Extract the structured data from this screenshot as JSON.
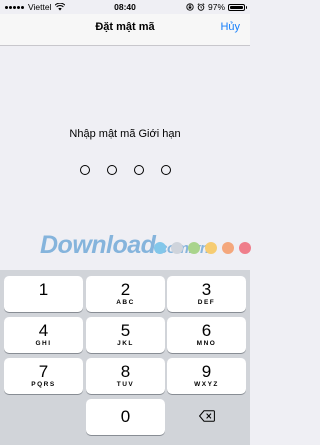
{
  "status_bar": {
    "carrier": "Viettel",
    "time": "08:40",
    "battery": "97%",
    "battery_level": 0.97
  },
  "nav": {
    "title": "Đặt mật mã",
    "cancel_label": "Hủy"
  },
  "passcode": {
    "prompt": "Nhập mật mã Giới hạn",
    "digits_entered": 0,
    "digits_total": 4
  },
  "watermark": {
    "text": "Download",
    "suffix": ".com.vn",
    "dot_colors": [
      "#83c7ea",
      "#cfd4dc",
      "#a9d48c",
      "#f6cc72",
      "#f4a77c",
      "#ef7e8b"
    ]
  },
  "keypad": {
    "keys": [
      {
        "num": "1",
        "letters": ""
      },
      {
        "num": "2",
        "letters": "ABC"
      },
      {
        "num": "3",
        "letters": "DEF"
      },
      {
        "num": "4",
        "letters": "GHI"
      },
      {
        "num": "5",
        "letters": "JKL"
      },
      {
        "num": "6",
        "letters": "MNO"
      },
      {
        "num": "7",
        "letters": "PQRS"
      },
      {
        "num": "8",
        "letters": "TUV"
      },
      {
        "num": "9",
        "letters": "WXYZ"
      },
      {
        "num": "0",
        "letters": ""
      }
    ],
    "delete_icon": "backspace-icon"
  }
}
